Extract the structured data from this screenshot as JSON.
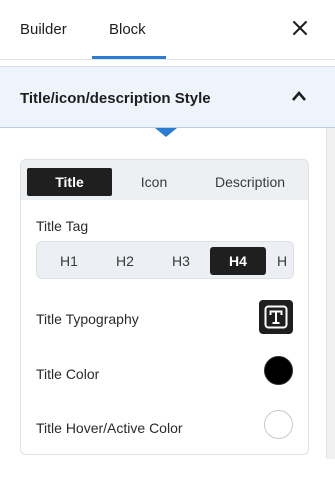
{
  "top_tabs": {
    "builder": "Builder",
    "block": "Block",
    "active": "Block"
  },
  "section": {
    "title": "Title/icon/description Style",
    "expanded": true
  },
  "sub_tabs": {
    "title": "Title",
    "icon": "Icon",
    "description": "Description",
    "active": "Title"
  },
  "fields": {
    "title_tag_label": "Title Tag",
    "title_tag_options": [
      "H1",
      "H2",
      "H3",
      "H4",
      "H"
    ],
    "title_tag_selected": "H4",
    "title_typography_label": "Title Typography",
    "title_color_label": "Title Color",
    "title_color_value": "#000000",
    "title_hover_label": "Title Hover/Active Color",
    "title_hover_value": "#ffffff"
  },
  "colors": {
    "accent": "#2b7cd3",
    "active_bg": "#1f1f1f",
    "section_bg": "#eef4fb"
  },
  "icons": {
    "close": "close-icon",
    "chevron": "chevron-up-icon",
    "typography": "typography-icon"
  }
}
